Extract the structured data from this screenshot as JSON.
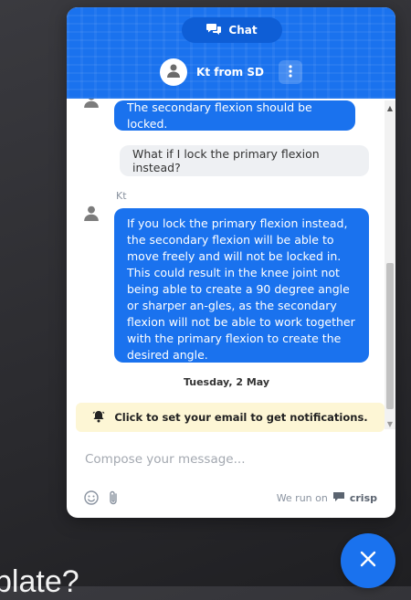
{
  "background": {
    "partial_text": "plate?"
  },
  "header": {
    "chat_tab_label": "Chat",
    "agent_name": "Kt from SD"
  },
  "messages": [
    {
      "from": "operator",
      "text": "The secondary flexion should be locked."
    },
    {
      "from": "user",
      "text": "What if I lock the primary flexion instead?"
    },
    {
      "from": "operator",
      "author": "Kt",
      "text": "If you lock the primary flexion instead, the secondary flexion will be able to move freely and will not be locked in. This could result in the knee joint not being able to create a 90 degree angle or sharper an-gles, as the secondary flexion will not be able to work together with the primary flexion to create the desired angle."
    }
  ],
  "date_separator": "Tuesday, 2 May",
  "notification_banner": "Click to set your email to get notifications.",
  "composer": {
    "placeholder": "Compose your message..."
  },
  "footer": {
    "powered_prefix": "We run on",
    "brand": "crisp"
  },
  "colors": {
    "accent": "#1a72ee",
    "banner": "#fdf6d5",
    "user_bubble": "#eef0f3"
  },
  "icons": [
    "chat-bubbles-icon",
    "user-avatar-icon",
    "more-vertical-icon",
    "bell-icon",
    "emoji-icon",
    "paperclip-icon",
    "crisp-logo-icon",
    "close-icon"
  ]
}
